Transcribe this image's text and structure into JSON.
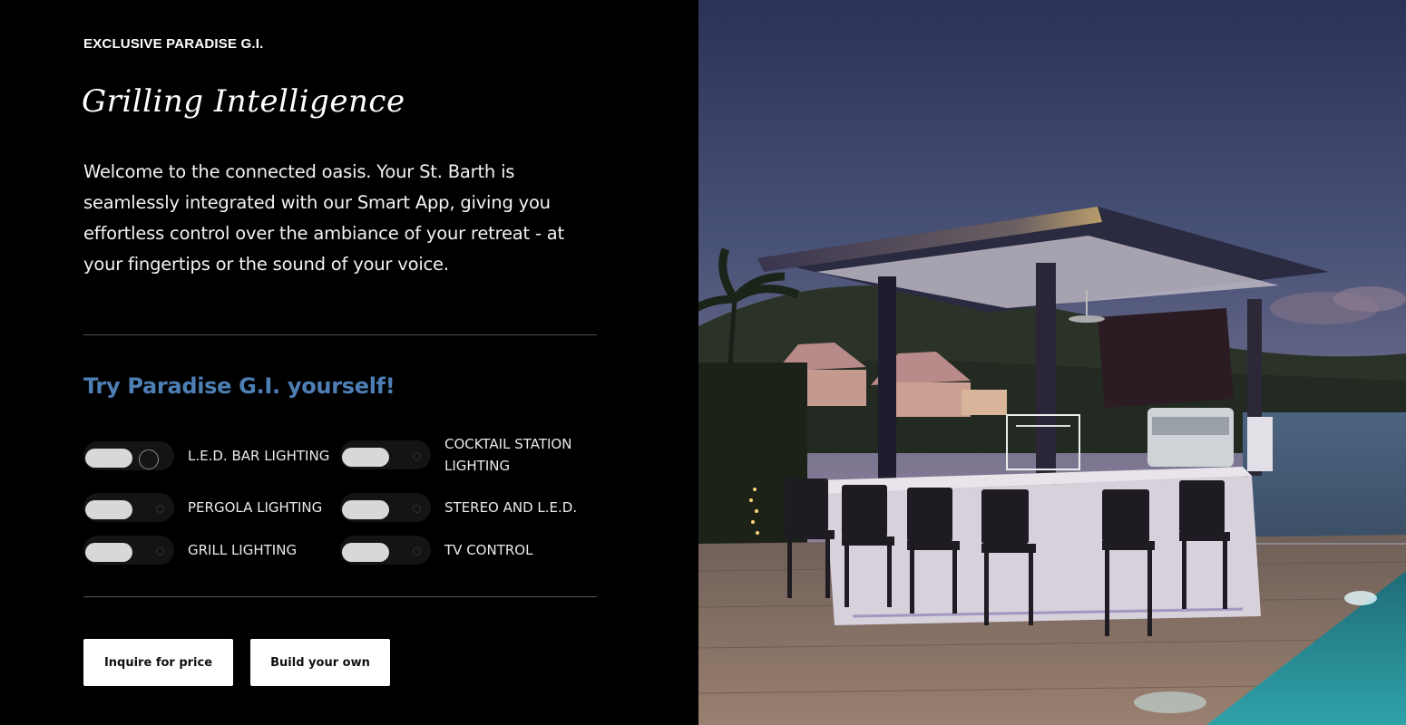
{
  "brand": {
    "eyebrow": "EXCLUSIVE PARADISE G.I."
  },
  "hero": {
    "script_title": "Grilling Intelligence",
    "intro": "Welcome to the connected oasis. Your St. Barth is seamlessly integrated with our Smart App, giving you effortless control over the ambiance of your retreat - at your fingertips or the sound of your voice."
  },
  "demo": {
    "title": "Try Paradise G.I. yourself!",
    "toggles": [
      {
        "label": "L.E.D. BAR LIGHTING",
        "state": "active"
      },
      {
        "label": "COCKTAIL STATION LIGHTING",
        "state": "off"
      },
      {
        "label": "PERGOLA LIGHTING",
        "state": "off"
      },
      {
        "label": "STEREO AND L.E.D.",
        "state": "off"
      },
      {
        "label": "GRILL LIGHTING",
        "state": "off"
      },
      {
        "label": "TV CONTROL",
        "state": "off"
      }
    ]
  },
  "actions": {
    "inquire_label": "Inquire for price",
    "build_label": "Build your own"
  },
  "colors": {
    "accent_blue": "#4d7fb4",
    "panel_bg": "#000000",
    "button_bg": "#ffffff"
  }
}
